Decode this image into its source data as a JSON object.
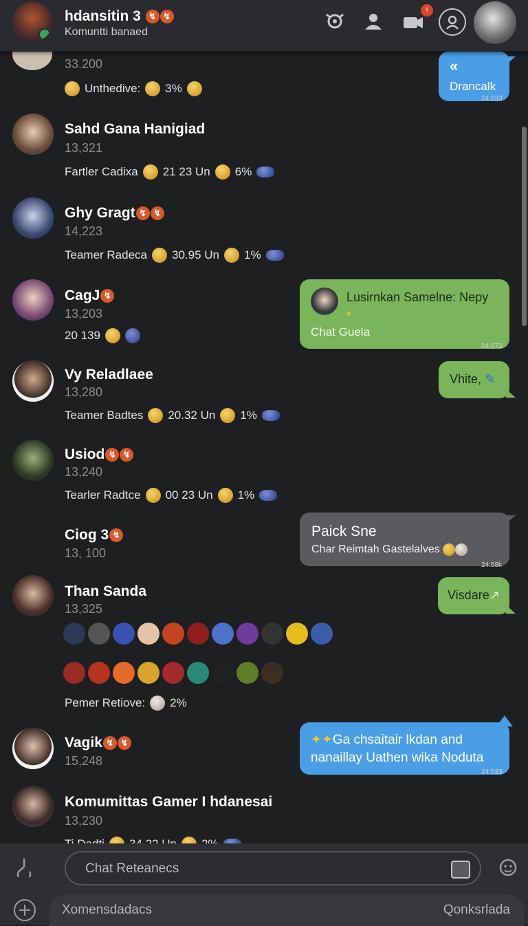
{
  "header": {
    "title": "hdansitin 3",
    "subtitle": "Komuntti banaed"
  },
  "contacts": [
    {
      "name": "",
      "count": "33.200",
      "stat_label": "Unthedive:",
      "stat_value": "3%"
    },
    {
      "name": "Sahd Gana Hanigiad",
      "count": "13,321",
      "stat_label": "Fartler Cadixa",
      "stat_mid": "21 23 Un",
      "stat_value": "6%"
    },
    {
      "name": "Ghy Gragt",
      "count": "14,223",
      "stat_label": "Teamer Radeca",
      "stat_mid": "30.95 Un",
      "stat_value": "1%"
    },
    {
      "name": "CagJ",
      "count": "13,203",
      "stat_label": "20 139"
    },
    {
      "name": "Vy Reladlaee",
      "count": "13,280",
      "stat_label": "Teamer Badtes",
      "stat_mid": "20.32 Un",
      "stat_value": "1%"
    },
    {
      "name": "Usiod",
      "count": "13,240",
      "stat_label": "Tearler Radtce",
      "stat_mid": "00 23 Un",
      "stat_value": "1%"
    },
    {
      "name": "Ciog 3",
      "count": "13, 100"
    },
    {
      "name": "Than Sanda",
      "count": "13,325",
      "stat_label": "Pemer Retiove:",
      "stat_value": "2%"
    },
    {
      "name": "Vagik",
      "count": "15,248"
    },
    {
      "name": "Komumittas Gamer I hdanesai",
      "count": "13,230",
      "stat_label": "Ti   Dadti",
      "stat_mid": "34 22 Un",
      "stat_value": "2%"
    }
  ],
  "bubbles": [
    {
      "text": "Drancalk",
      "time": "24:533",
      "color": "#4a9ee6"
    },
    {
      "text": "Lusirnkan Samelne: Nepy",
      "sub": "Chat Guela",
      "time": "24:573",
      "color": "#7ab55c"
    },
    {
      "text": "Vhite,",
      "color": "#7ab55c"
    },
    {
      "text": "Paick Sne",
      "sub": "Char Reimtah Gastelalves",
      "time": "24:58k",
      "color": "#5a5b5e"
    },
    {
      "text": "Visdare",
      "color": "#7ab55c"
    },
    {
      "text": "Ga chsaitair lkdan and",
      "text2": "nanaillay Uathen wika Noduta",
      "time": "24:533",
      "color": "#4a9ee6"
    }
  ],
  "input": {
    "placeholder": "Chat Reteanecs",
    "bottom_left": "Xomensdadacs",
    "bottom_right": "Qonksrlada"
  },
  "icons": {
    "header": [
      "gamepad-icon",
      "user-add-icon",
      "video-icon",
      "profile-icon"
    ],
    "bottom": [
      "attach-icon",
      "emoji-icon",
      "add-icon"
    ]
  }
}
